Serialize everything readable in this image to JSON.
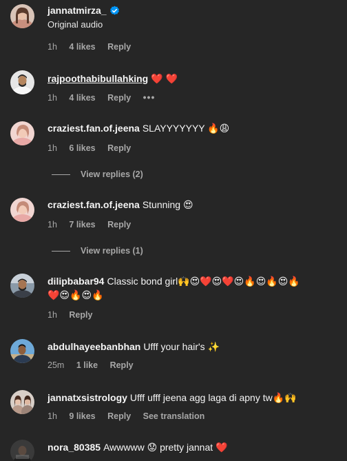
{
  "comments": [
    {
      "username": "jannatmirza_",
      "verified": true,
      "subtext": "Original audio",
      "text": "",
      "time": "1h",
      "likes": "4 likes",
      "reply": "Reply"
    },
    {
      "username": "rajpoothabibullahking",
      "text": "❤️ ❤️",
      "time": "1h",
      "likes": "4 likes",
      "reply": "Reply",
      "more": "•••"
    },
    {
      "username": "craziest.fan.of.jeena",
      "text": "SLAYYYYYYY 🔥😩",
      "time": "1h",
      "likes": "6 likes",
      "reply": "Reply",
      "view_replies": "View replies (2)"
    },
    {
      "username": "craziest.fan.of.jeena",
      "text": "Stunning 😍",
      "time": "1h",
      "likes": "7 likes",
      "reply": "Reply",
      "view_replies": "View replies (1)"
    },
    {
      "username": "dilipbabar94",
      "text": "Classic bond girl🙌😍❤️😍❤️😍🔥😍🔥😍🔥",
      "text2": "❤️😍🔥😍🔥",
      "time": "1h",
      "reply": "Reply"
    },
    {
      "username": "abdulhayeebanbhan",
      "text": "Ufff your hair's ✨",
      "time": "25m",
      "likes": "1 like",
      "reply": "Reply"
    },
    {
      "username": "jannatxsistrology",
      "text": "Ufff ufff jeena agg laga di apny tw🔥🙌",
      "time": "1h",
      "likes": "9 likes",
      "reply": "Reply",
      "see_translation": "See translation"
    },
    {
      "username": "nora_80385",
      "text": "Awwwww 😟 pretty jannat ❤️"
    }
  ],
  "avatar_icons": [
    "woman-portrait",
    "man-white-shirt",
    "woman-pink",
    "woman-pink",
    "man-bearded",
    "man-blue-sky",
    "two-women",
    "dark-figure"
  ]
}
